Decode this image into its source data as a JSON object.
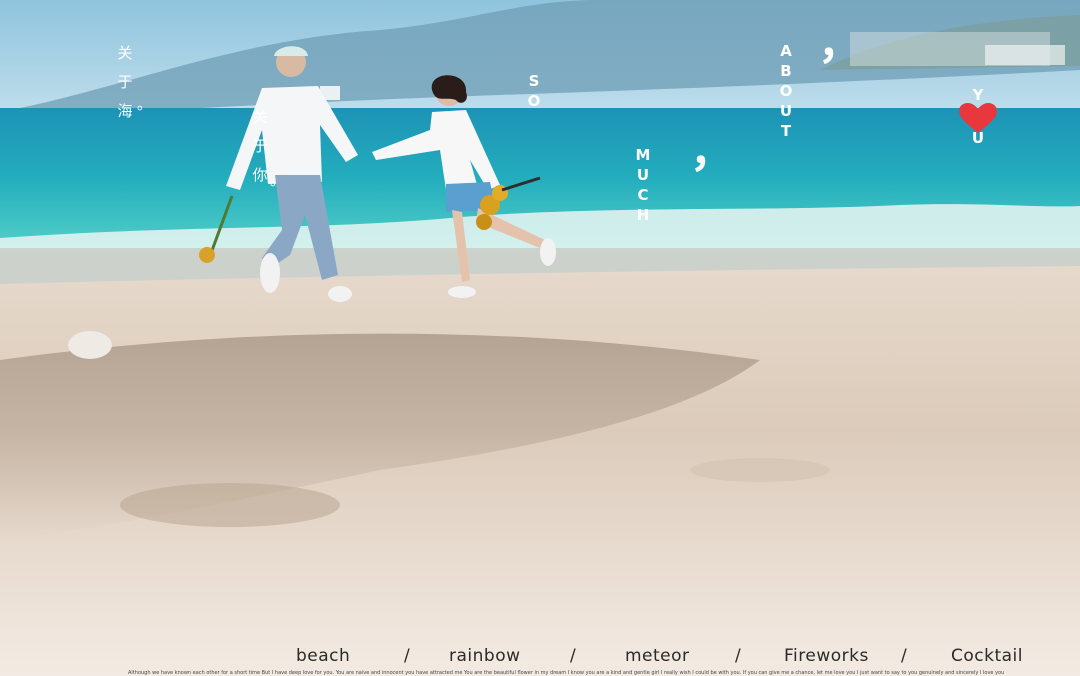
{
  "vertical_chinese": {
    "col1": [
      "关",
      "于",
      "海",
      "。"
    ],
    "col2": [
      "关",
      "于",
      "你",
      "。"
    ]
  },
  "vertical_english": {
    "so": [
      "S",
      "O"
    ],
    "much": [
      "M",
      "U",
      "C",
      "H"
    ],
    "about": [
      "A",
      "B",
      "O",
      "U",
      "T"
    ],
    "you": [
      "Y",
      "U"
    ]
  },
  "commas": [
    "，",
    "，",
    "，"
  ],
  "bottom_words": [
    "beach",
    "/",
    "rainbow",
    "/",
    "meteor",
    "/",
    "Fireworks",
    "/",
    "Cocktail"
  ],
  "caption": "Although we have known each other for a short time But I have deep love for you. You are naive and innocent you have attracted me You are the beautiful flower in my dream I know you are a kind and gentle girl I really wish I could be with you. If you can give me a chance, let me love you I just want to say to you genuinely and sincerely I love you",
  "colors": {
    "sky": "#a9cfe2",
    "sea": "#27b3c0",
    "sand": "#eadfd2",
    "heart": "#e8383d",
    "text_light": "#ffffff",
    "text_dark": "#2a2a2a"
  }
}
